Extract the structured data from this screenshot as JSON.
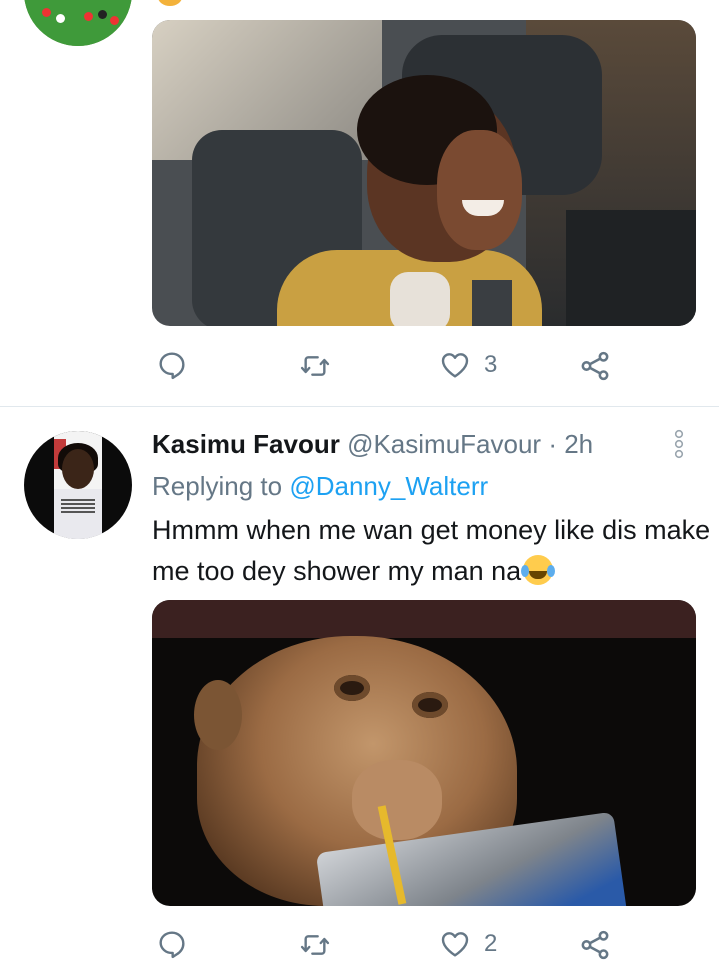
{
  "tweet_above": {
    "actions": {
      "reply": {
        "icon": "reply-icon"
      },
      "retweet": {
        "icon": "retweet-icon"
      },
      "like": {
        "icon": "heart-icon",
        "count": "3"
      },
      "share": {
        "icon": "share-icon"
      }
    }
  },
  "tweet": {
    "display_name": "Kasimu Favour",
    "handle": "@KasimuFavour",
    "separator": "·",
    "time": "2h",
    "replying_to_label": "Replying to",
    "replying_to_mention": "@Danny_Walterr",
    "text": "Hmmm when me wan get money like dis make  me too dey shower my man na",
    "emoji": "face-with-tears-of-joy",
    "actions": {
      "reply": {
        "icon": "reply-icon"
      },
      "retweet": {
        "icon": "retweet-icon"
      },
      "like": {
        "icon": "heart-icon",
        "count": "2"
      },
      "share": {
        "icon": "share-icon"
      }
    }
  },
  "colors": {
    "link": "#1da1f2",
    "secondary_text": "#657786",
    "primary_text": "#14171a",
    "divider": "#e1e8ed"
  }
}
